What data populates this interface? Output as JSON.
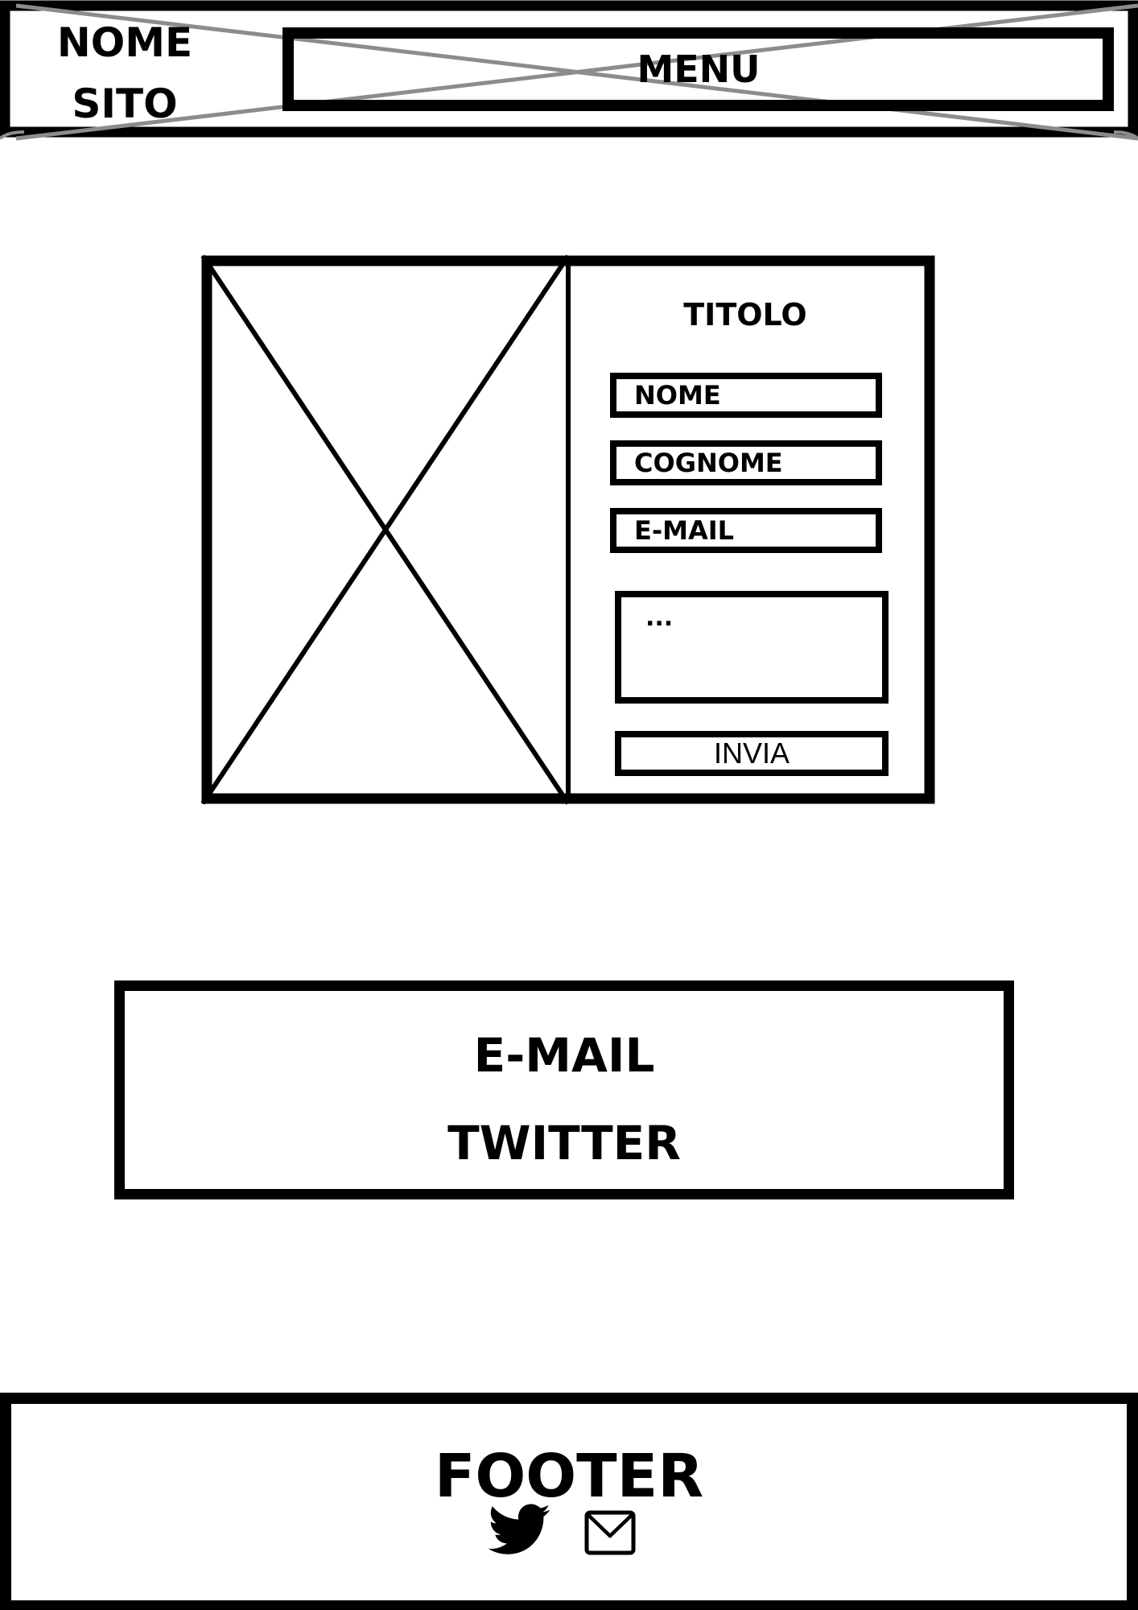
{
  "header": {
    "site_name_line1": "NOME",
    "site_name_line2": "SITO",
    "menu_label": "MENU"
  },
  "contact_form": {
    "title": "TITOLO",
    "fields": [
      "NOME",
      "COGNOME",
      "E-MAIL"
    ],
    "message_placeholder": "...",
    "submit_label": "INVIA"
  },
  "contact_links": {
    "email_label": "E-MAIL",
    "twitter_label": "TWITTER"
  },
  "footer": {
    "title": "FOOTER",
    "icons": [
      "twitter-icon",
      "mail-icon"
    ]
  },
  "colors": {
    "ink": "#000000",
    "background": "#ffffff",
    "placeholder_cross": "#8c8c8c"
  }
}
